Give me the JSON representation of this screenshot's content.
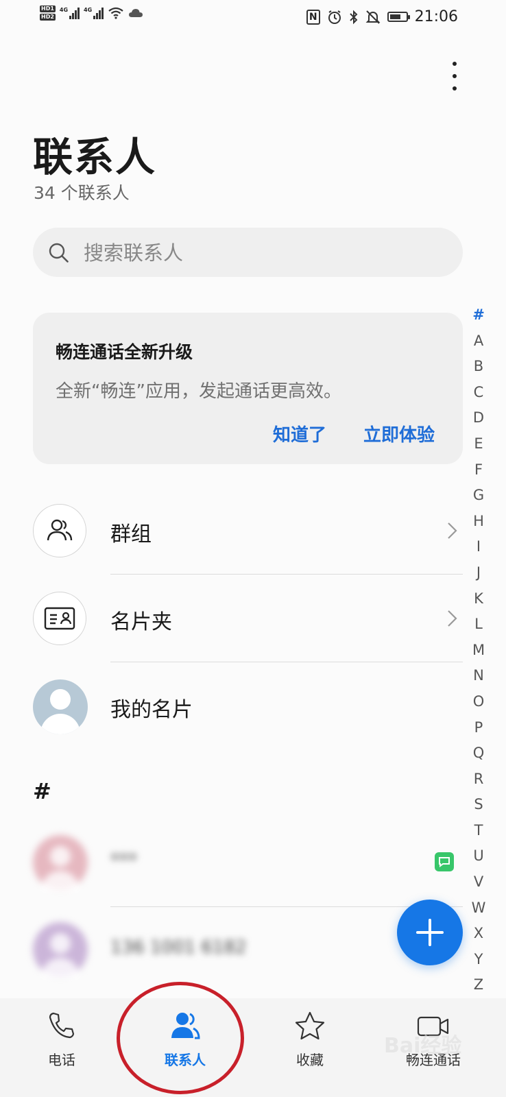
{
  "status_bar": {
    "hd1": "HD1",
    "hd2": "HD2",
    "net1": "4G",
    "net2": "4G",
    "nfc": "N",
    "time": "21:06",
    "battery_level": 0.6
  },
  "header": {
    "title": "联系人",
    "subtitle": "34 个联系人"
  },
  "search": {
    "placeholder": "搜索联系人"
  },
  "banner": {
    "title": "畅连通话全新升级",
    "desc": "全新“畅连”应用，发起通话更高效。",
    "dismiss": "知道了",
    "try_now": "立即体验"
  },
  "rows": {
    "groups": "群组",
    "cards": "名片夹",
    "my_card": "我的名片"
  },
  "section_header": "#",
  "contacts": [
    {
      "name": "***",
      "avatar_color": "#e6b8c0"
    },
    {
      "name": "136 1001 6182",
      "avatar_color": "#cbb5d9"
    }
  ],
  "index_letters": [
    "#",
    "A",
    "B",
    "C",
    "D",
    "E",
    "F",
    "G",
    "H",
    "I",
    "J",
    "K",
    "L",
    "M",
    "N",
    "O",
    "P",
    "Q",
    "R",
    "S",
    "T",
    "U",
    "V",
    "W",
    "X",
    "Y",
    "Z"
  ],
  "nav": {
    "phone": "电话",
    "contacts": "联系人",
    "favorites": "收藏",
    "meetime": "畅连通话"
  },
  "watermark": "Bai经验",
  "colors": {
    "accent": "#1677e6",
    "link": "#1f6dd7",
    "annotation_ring": "#c8202a"
  }
}
